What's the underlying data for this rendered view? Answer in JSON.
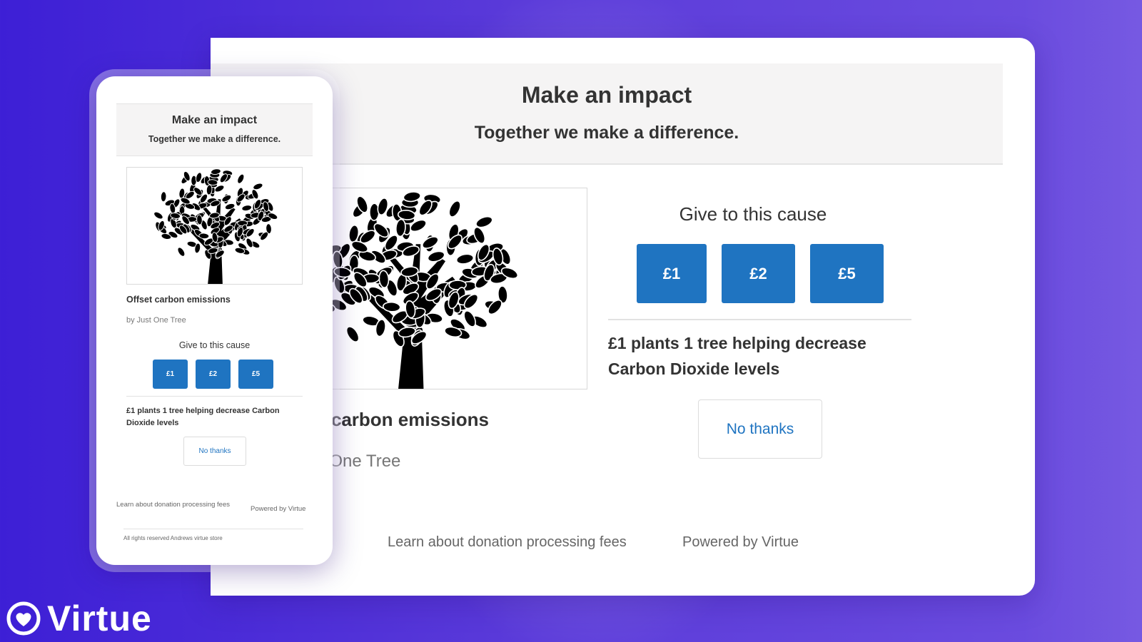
{
  "brand": {
    "name": "Virtue",
    "icon": "heart-circle-icon"
  },
  "colors": {
    "accent": "#1f74c1",
    "background": "#4a2bd8",
    "panel": "#ffffff",
    "header_bg": "#f5f4f4"
  },
  "desktop": {
    "header": {
      "title": "Make an impact",
      "subtitle": "Together we make a difference."
    },
    "cause": {
      "title_partial": ": carbon emissions",
      "by_partial": "t One Tree",
      "image": "tree-illustration"
    },
    "give": {
      "title": "Give to this cause",
      "amounts": [
        "£1",
        "£2",
        "£5"
      ],
      "impact_text": "£1 plants 1 tree helping decrease Carbon Dioxide levels",
      "no_thanks": "No thanks"
    },
    "footer": {
      "fees_link": "Learn about donation processing fees",
      "powered_by": "Powered by Virtue"
    }
  },
  "mobile": {
    "header": {
      "title": "Make an impact",
      "subtitle": "Together we make a difference."
    },
    "cause": {
      "title": "Offset carbon emissions",
      "by": "by Just One Tree",
      "image": "tree-illustration"
    },
    "give": {
      "title": "Give to this cause",
      "amounts": [
        "£1",
        "£2",
        "£5"
      ],
      "impact_text": "£1 plants 1 tree helping decrease Carbon Dioxide levels",
      "no_thanks": "No thanks"
    },
    "footer": {
      "fees_link": "Learn about donation processing fees",
      "powered_by": "Powered by Virtue",
      "rights": "All rights reserved Andrews virtue store"
    }
  }
}
